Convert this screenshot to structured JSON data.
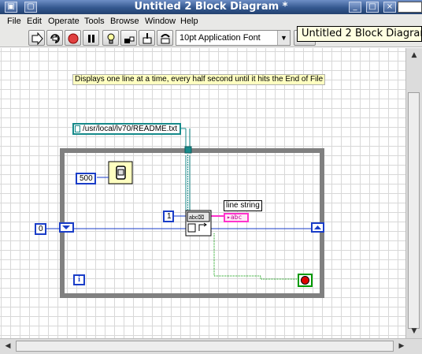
{
  "window": {
    "title": "Untitled 2 Block Diagram *",
    "controls": {
      "minimize": "_",
      "maximize": "□",
      "close": "×"
    }
  },
  "menu": [
    "File",
    "Edit",
    "Operate",
    "Tools",
    "Browse",
    "Window",
    "Help"
  ],
  "toolbar": {
    "buttons": [
      "run-arrow-icon",
      "run-continuously-icon",
      "abort-icon",
      "pause-icon",
      "highlight-execution-icon",
      "retain-wire-values-icon",
      "step-into-icon",
      "step-over-icon"
    ],
    "font_select": "10pt Application Font"
  },
  "tooltip": "Untitled 2 Block Diagram *",
  "diagram": {
    "comment": "Displays one line at a time, every half second until it hits the End of File",
    "path_constant": "/usr/local/lv70/README.txt",
    "wait_constant": "500",
    "shift_register_init": "0",
    "read_count": "1",
    "indicator_label": "line string",
    "indicator_type": "abc",
    "loop_iteration": "i"
  },
  "colors": {
    "titlebar": "#34588f",
    "number_wire": "#1a3dc8",
    "path_wire": "#168a8a",
    "string_wire": "#ff33cc",
    "boolean_wire": "#009900",
    "loop_border": "#808080"
  }
}
